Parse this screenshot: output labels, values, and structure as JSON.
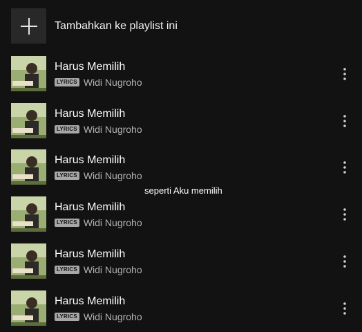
{
  "add_to_playlist": {
    "label": "Tambahkan ke playlist ini",
    "icon": "plus-icon"
  },
  "lyric_caption": "seperti Aku memilih",
  "tracks": [
    {
      "title": "Harus Memilih",
      "badge": "LYRICS",
      "artist": "Widi Nugroho"
    },
    {
      "title": "Harus Memilih",
      "badge": "LYRICS",
      "artist": "Widi Nugroho"
    },
    {
      "title": "Harus Memilih",
      "badge": "LYRICS",
      "artist": "Widi Nugroho"
    },
    {
      "title": "Harus Memilih",
      "badge": "LYRICS",
      "artist": "Widi Nugroho"
    },
    {
      "title": "Harus Memilih",
      "badge": "LYRICS",
      "artist": "Widi Nugroho"
    },
    {
      "title": "Harus Memilih",
      "badge": "LYRICS",
      "artist": "Widi Nugroho"
    }
  ],
  "colors": {
    "background": "#121212",
    "tile": "#282828",
    "secondary_text": "#b3b3b3",
    "badge": "#a7a7a7"
  }
}
